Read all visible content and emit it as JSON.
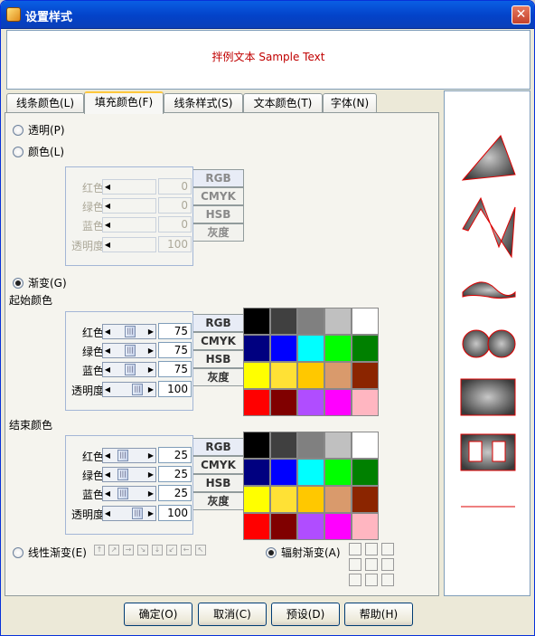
{
  "window": {
    "title": "设置样式",
    "close_glyph": "✕"
  },
  "preview_text": "拌例文本 Sample Text",
  "tabs": [
    "线条颜色(L)",
    "填充颜色(F)",
    "线条样式(S)",
    "文本颜色(T)",
    "字体(N)"
  ],
  "fill": {
    "transparent_label": "透明(P)",
    "color_label": "颜色(L)",
    "gradient_label": "渐变(G)",
    "start_color_label": "起始颜色",
    "end_color_label": "结束颜色",
    "linear_label": "线性渐变(E)",
    "radial_label": "辐射渐变(A)",
    "selected_mode": "gradient",
    "selected_gradient": "radial"
  },
  "color_rows": [
    "红色",
    "绿色",
    "蓝色",
    "透明度"
  ],
  "color_modes": [
    "RGB",
    "CMYK",
    "HSB",
    "灰度"
  ],
  "solid_values": [
    "0",
    "0",
    "0",
    "100"
  ],
  "start_values": [
    "75",
    "75",
    "75",
    "100"
  ],
  "end_values": [
    "25",
    "25",
    "25",
    "100"
  ],
  "swatch_colors": [
    "#000000",
    "#404040",
    "#808080",
    "#c0c0c0",
    "#ffffff",
    "#000080",
    "#0000ff",
    "#00ffff",
    "#00ff00",
    "#008000",
    "#ffff00",
    "#ffe135",
    "#ffc800",
    "#d99a6c",
    "#8b2500",
    "#ff0000",
    "#800000",
    "#b04dff",
    "#ff00ff",
    "#ffb6c1"
  ],
  "buttons": {
    "ok": "确定(O)",
    "cancel": "取消(C)",
    "default": "预设(D)",
    "help": "帮助(H)"
  },
  "shapes": [
    "triangle",
    "bowtie",
    "wave",
    "two-circles",
    "rectangle",
    "rectangle-with-holes",
    "line"
  ]
}
